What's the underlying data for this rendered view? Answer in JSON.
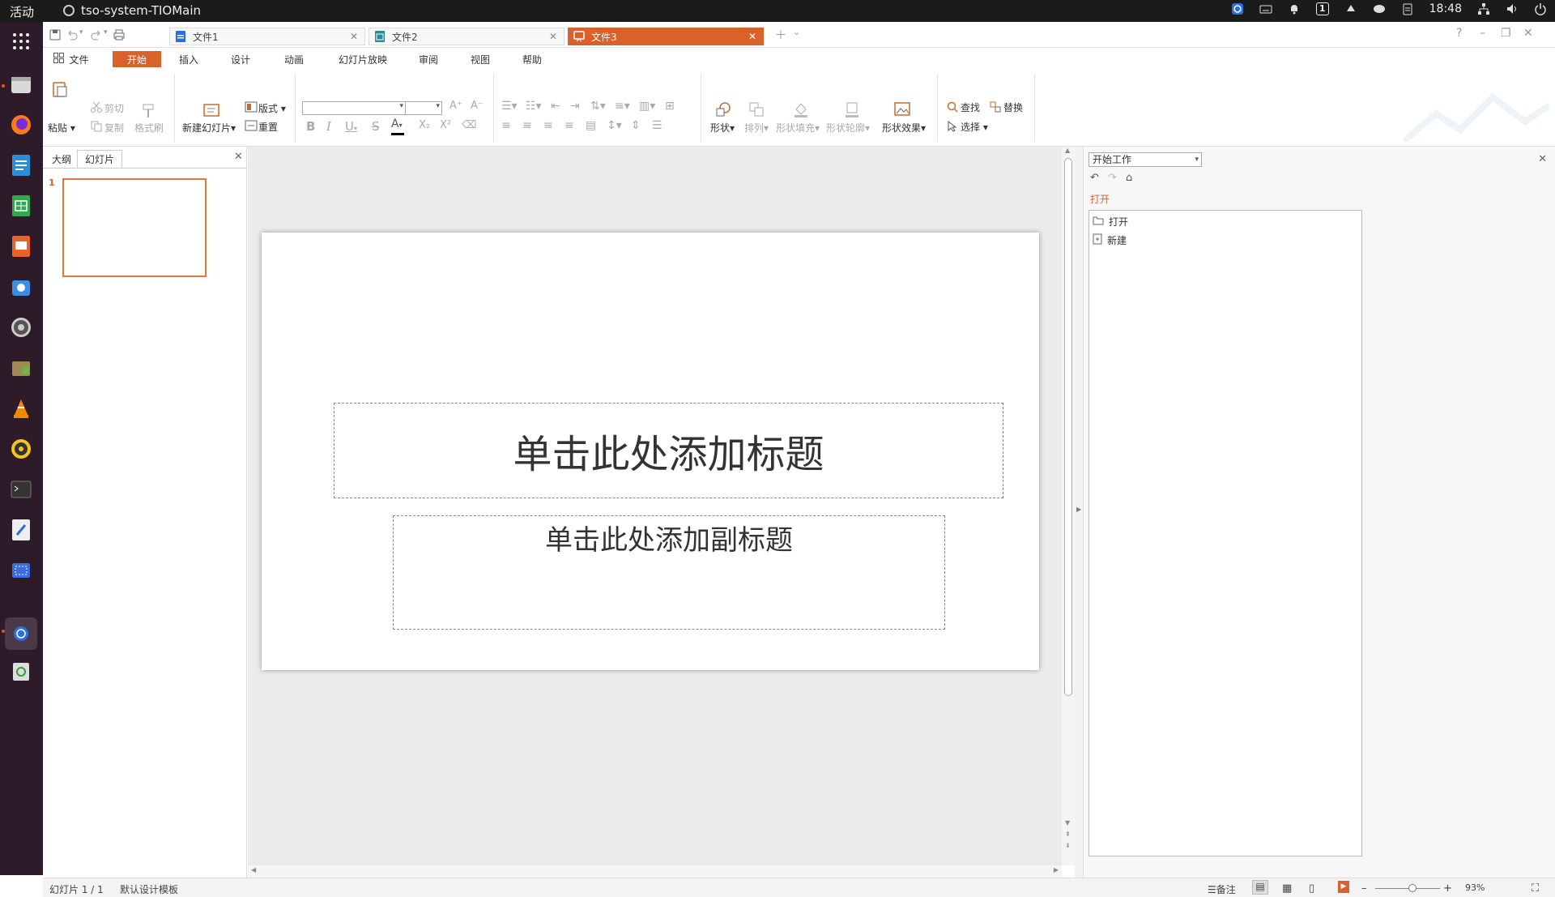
{
  "system_bar": {
    "activities": "活动",
    "app_name": "tso-system-TIOMain",
    "time": "18:48",
    "workspace_number": "1"
  },
  "colors": {
    "accent": "#d9612a",
    "dock_bg": "#2d1b2a",
    "topbar_bg": "#1b1b1b"
  },
  "tabs": [
    {
      "label": "文件1",
      "icon": "writer-doc-icon",
      "active": false
    },
    {
      "label": "文件2",
      "icon": "spreadsheet-doc-icon",
      "active": false
    },
    {
      "label": "文件3",
      "icon": "presentation-doc-icon",
      "active": true
    }
  ],
  "menu": {
    "file": "文件",
    "items": [
      "开始",
      "插入",
      "设计",
      "动画",
      "幻灯片放映",
      "审阅",
      "视图",
      "帮助"
    ],
    "active": "开始"
  },
  "ribbon": {
    "paste": "粘贴",
    "cut": "剪切",
    "copy": "复制",
    "format_painter": "格式刷",
    "new_slide": "新建幻灯片",
    "layout": "版式",
    "reset": "重置",
    "shape": "形状",
    "arrange": "排列",
    "shape_fill": "形状填充",
    "shape_outline": "形状轮廓",
    "shape_effect": "形状效果",
    "find": "查找",
    "replace": "替换",
    "select": "选择"
  },
  "left_panel": {
    "tab_outline": "大纲",
    "tab_slides": "幻灯片",
    "slide_number": "1"
  },
  "slide": {
    "title_placeholder": "单击此处添加标题",
    "subtitle_placeholder": "单击此处添加副标题"
  },
  "task_pane": {
    "dropdown": "开始工作",
    "section": "打开",
    "items": [
      "打开",
      "新建"
    ]
  },
  "status_bar": {
    "slide_info": "幻灯片 1 / 1",
    "template": "默认设计模板",
    "notes": "备注",
    "zoom": "93%"
  }
}
